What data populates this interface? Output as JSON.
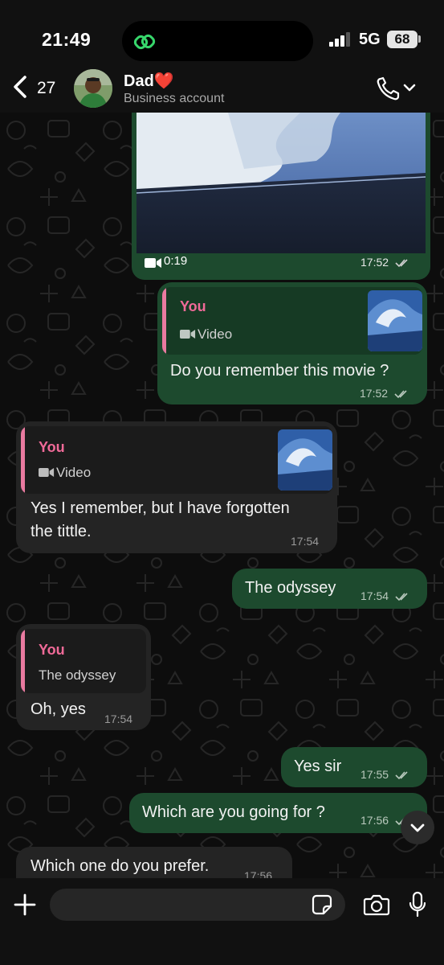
{
  "status": {
    "time": "21:49",
    "network": "5G",
    "battery": "68"
  },
  "header": {
    "back_count": "27",
    "name": "Dad❤️",
    "subtitle": "Business account",
    "call_icon": "phone-icon"
  },
  "messages": [
    {
      "id": "video",
      "type": "video",
      "duration": "0:19",
      "time": "17:52",
      "status": "read"
    },
    {
      "id": "m1",
      "direction": "out",
      "quote": {
        "author": "You",
        "label": "Video"
      },
      "text": "Do you remember this movie ?",
      "time": "17:52",
      "status": "read"
    },
    {
      "id": "m2",
      "direction": "in",
      "quote": {
        "author": "You",
        "label": "Video"
      },
      "text_line1": "Yes I remember, but I have forgotten",
      "text_line2": "the tittle.",
      "time": "17:54"
    },
    {
      "id": "m3",
      "direction": "out",
      "text": "The odyssey",
      "time": "17:54",
      "status": "read"
    },
    {
      "id": "m4",
      "direction": "in",
      "quote": {
        "author": "You",
        "label": "The odyssey"
      },
      "text": "Oh, yes",
      "time": "17:54"
    },
    {
      "id": "m5",
      "direction": "out",
      "text": "Yes sir",
      "time": "17:55",
      "status": "read"
    },
    {
      "id": "m6",
      "direction": "out",
      "text": "Which are you going for ?",
      "time": "17:56",
      "status": "read"
    },
    {
      "id": "m7",
      "direction": "in",
      "text": "Which one do you prefer.",
      "time": "17:56"
    }
  ],
  "composer": {
    "placeholder": ""
  },
  "colors": {
    "outgoing": "#1d4a2e",
    "incoming": "#242424",
    "quote_accent": "#f06a98",
    "read_ticks": "#b9c9bd"
  }
}
